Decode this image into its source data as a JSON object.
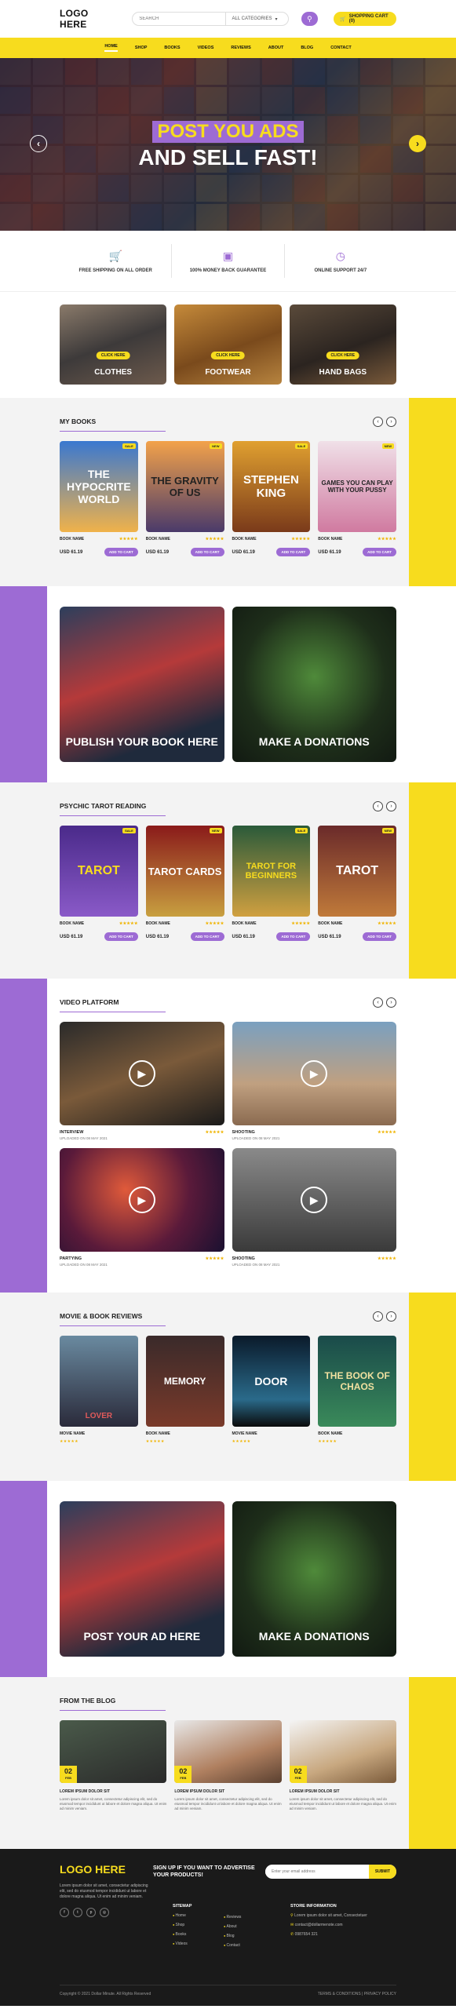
{
  "header": {
    "logo": "LOGO HERE",
    "search_placeholder": "SEARCH",
    "category": "ALL CATEGORIES",
    "cart": "SHOPPING CART (0)"
  },
  "nav": [
    "HOME",
    "SHOP",
    "BOOKS",
    "VIDEOS",
    "REVIEWS",
    "ABOUT",
    "BLOG",
    "CONTACT"
  ],
  "hero": {
    "line1": "POST YOU ADS",
    "line2": "AND SELL FAST!"
  },
  "features": [
    "FREE SHIPPING ON ALL ORDER",
    "100% MONEY BACK GUARANTEE",
    "ONLINE SUPPORT 24/7"
  ],
  "categories": [
    {
      "label": "CLOTHES",
      "badge": "CLICK HERE"
    },
    {
      "label": "FOOTWEAR",
      "badge": "CLICK HERE"
    },
    {
      "label": "HAND BAGS",
      "badge": "CLICK HERE"
    }
  ],
  "my_books": {
    "title": "MY BOOKS",
    "items": [
      {
        "cover": "THE HYPOCRITE WORLD",
        "tag": "SALE",
        "name": "BOOK NAME",
        "price": "USD 61.19",
        "btn": "ADD TO CART"
      },
      {
        "cover": "THE GRAVITY OF US",
        "tag": "NEW",
        "name": "BOOK NAME",
        "price": "USD 61.19",
        "btn": "ADD TO CART"
      },
      {
        "cover": "STEPHEN KING",
        "tag": "SALE",
        "name": "BOOK NAME",
        "price": "USD 61.19",
        "btn": "ADD TO CART"
      },
      {
        "cover": "GAMES YOU CAN PLAY WITH YOUR PUSSY",
        "tag": "NEW",
        "name": "BOOK NAME",
        "price": "USD 61.19",
        "btn": "ADD TO CART"
      }
    ]
  },
  "promo1": [
    "PUBLISH YOUR BOOK HERE",
    "MAKE A DONATIONS"
  ],
  "tarot": {
    "title": "PSYCHIC TAROT READING",
    "items": [
      {
        "cover": "TAROT",
        "tag": "SALE",
        "name": "BOOK NAME",
        "price": "USD 61.19",
        "btn": "ADD TO CART"
      },
      {
        "cover": "TAROT CARDS",
        "tag": "NEW",
        "name": "BOOK NAME",
        "price": "USD 61.19",
        "btn": "ADD TO CART"
      },
      {
        "cover": "TAROT FOR BEGINNERS",
        "tag": "SALE",
        "name": "BOOK NAME",
        "price": "USD 61.19",
        "btn": "ADD TO CART"
      },
      {
        "cover": "TAROT",
        "tag": "NEW",
        "name": "BOOK NAME",
        "price": "USD 61.19",
        "btn": "ADD TO CART"
      }
    ]
  },
  "video": {
    "title": "VIDEO PLATFORM",
    "items": [
      {
        "label": "INTERVIEW",
        "sub": "UPLOADED ON 08 MAY 2021"
      },
      {
        "label": "SHOOTING",
        "sub": "UPLOADED ON 08 MAY 2021"
      },
      {
        "label": "PARTYING",
        "sub": "UPLOADED ON 08 MAY 2021"
      },
      {
        "label": "SHOOTING",
        "sub": "UPLOADED ON 08 MAY 2021"
      }
    ]
  },
  "reviews": {
    "title": "MOVIE & BOOK REVIEWS",
    "items": [
      {
        "cover": "LOVER",
        "name": "MOVIE NAME"
      },
      {
        "cover": "MEMORY",
        "name": "BOOK NAME"
      },
      {
        "cover": "DOOR",
        "name": "MOVIE NAME"
      },
      {
        "cover": "THE BOOK OF CHAOS",
        "name": "BOOK NAME"
      }
    ]
  },
  "promo2": [
    "POST YOUR AD HERE",
    "MAKE A DONATIONS"
  ],
  "blog": {
    "title": "FROM THE BLOG",
    "items": [
      {
        "day": "02",
        "mon": "FEB",
        "title": "LOREM IPSUM DOLOR SIT",
        "text": "Lorem ipsum dolor sit amet, consectetur adipiscing elit, sed do eiusmod tempor incididunt ut labore et dolore magna aliqua. Ut enim ad minim veniam."
      },
      {
        "day": "02",
        "mon": "FEB",
        "title": "LOREM IPSUM DOLOR SIT",
        "text": "Lorem ipsum dolor sit amet, consectetur adipiscing elit, sed do eiusmod tempor incididunt ut labore et dolore magna aliqua. Ut enim ad minim veniam."
      },
      {
        "day": "02",
        "mon": "FEB",
        "title": "LOREM IPSUM DOLOR SIT",
        "text": "Lorem ipsum dolor sit amet, consectetur adipiscing elit, sed do eiusmod tempor incididunt ut labore et dolore magna aliqua. Ut enim ad minim veniam."
      }
    ]
  },
  "footer": {
    "logo": "LOGO HERE",
    "text": "Lorem ipsum dolor sit amet, consectetur adipiscing elit, sed do eiusmod tempor incididunt ut labore et dolore magna aliqua. Ut enim ad minim veniam.",
    "signup": "SIGN UP IF YOU WANT TO ADVERTISE YOUR PRODUCTS!",
    "email_placeholder": "Enter your email address",
    "submit": "SUBMIT",
    "sitemap_title": "SITEMAP",
    "sitemap_a": [
      "Home",
      "Shop",
      "Books",
      "Videos"
    ],
    "sitemap_b": [
      "Reviews",
      "About",
      "Blog",
      "Contact"
    ],
    "store_title": "STORE INFORMATION",
    "address": "Lorem ipsum dolor sit amet, Consectetuer",
    "email": "contact@dollarmenote.com",
    "phone": "0987654 321",
    "copyright": "Copyright © 2021 Dollar Minute. All Rights Reserved",
    "links": "TERMS & CONDITIONS  |  PRIVACY POLICY"
  }
}
